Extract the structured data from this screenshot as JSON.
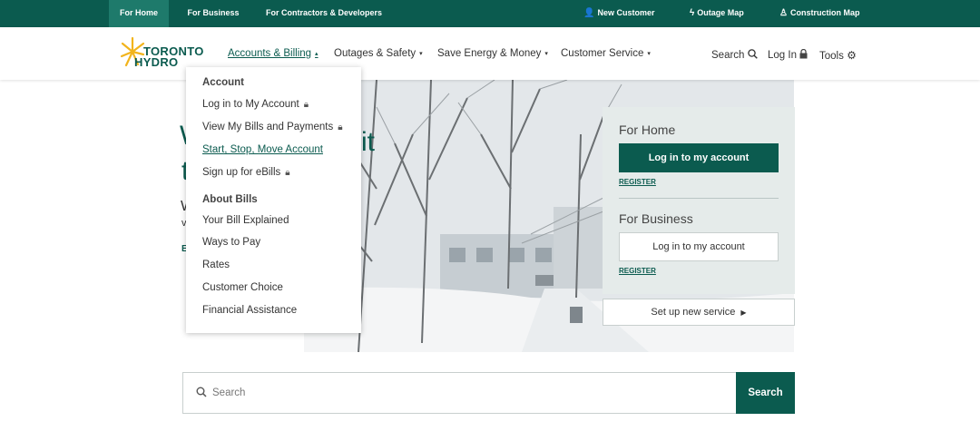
{
  "topbar": {
    "tabs": [
      {
        "label": "For Home",
        "active": true
      },
      {
        "label": "For Business",
        "active": false
      },
      {
        "label": "For Contractors & Developers",
        "active": false
      }
    ],
    "utility_links": [
      {
        "label": "New Customer",
        "icon": "add-user-icon"
      },
      {
        "label": "Outage Map",
        "icon": "lightning-icon"
      },
      {
        "label": "Construction Map",
        "icon": "construction-worker-icon"
      }
    ]
  },
  "header": {
    "logo_line1": "TORONTO",
    "logo_line2": "HYDRO",
    "nav": [
      {
        "label": "Accounts & Billing",
        "active": true,
        "caret": "▴"
      },
      {
        "label": "Outages & Safety",
        "active": false,
        "caret": "▾"
      },
      {
        "label": "Save Energy & Money",
        "active": false,
        "caret": "▾"
      },
      {
        "label": "Customer Service",
        "active": false,
        "caret": "▾"
      }
    ],
    "search_label": "Search",
    "login_label": "Log In",
    "tools_label": "Tools"
  },
  "dropdown": {
    "account_heading": "Account",
    "account_links": [
      {
        "label": "Log in to My Account",
        "locked": true
      },
      {
        "label": "View My Bills and Payments",
        "locked": true
      },
      {
        "label": "Start, Stop, Move Account",
        "locked": false,
        "highlighted": true
      },
      {
        "label": "Sign up for eBills",
        "locked": true
      }
    ],
    "bills_heading": "About Bills",
    "bills_links": [
      {
        "label": "Your Bill Explained"
      },
      {
        "label": "Ways to Pay"
      },
      {
        "label": "Rates"
      },
      {
        "label": "Customer Choice"
      },
      {
        "label": "Financial Assistance"
      }
    ]
  },
  "hero": {
    "partial_text_1": "W",
    "partial_text_2": "it",
    "partial_text_3": "t",
    "partial_text_4": "W",
    "partial_text_5": "v",
    "partial_text_6": "E"
  },
  "login_panel": {
    "home_title": "For Home",
    "home_button": "Log in to my account",
    "home_register": "REGISTER",
    "business_title": "For Business",
    "business_button": "Log in to my account",
    "business_register": "REGISTER"
  },
  "setup_service": "Set up new service",
  "search": {
    "placeholder": "Search",
    "value": "",
    "button_label": "Search"
  },
  "colors": {
    "brand_green": "#0b5b4f",
    "panel_bg": "#e5ebea",
    "logo_sun": "#f2b41c"
  }
}
